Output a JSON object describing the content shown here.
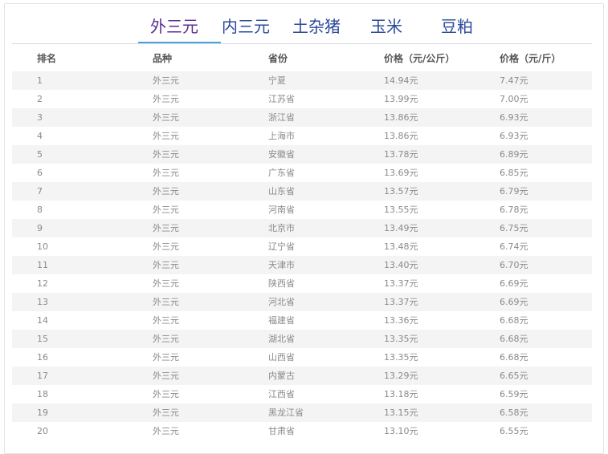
{
  "tabs": [
    {
      "label": "外三元",
      "active": true
    },
    {
      "label": "内三元",
      "active": false
    },
    {
      "label": "土杂猪",
      "active": false
    },
    {
      "label": "玉米",
      "active": false
    },
    {
      "label": "豆粕",
      "active": false
    }
  ],
  "table": {
    "headers": [
      "排名",
      "品种",
      "省份",
      "价格（元/公斤）",
      "价格（元/斤）"
    ],
    "rows": [
      [
        "1",
        "外三元",
        "宁夏",
        "14.94元",
        "7.47元"
      ],
      [
        "2",
        "外三元",
        "江苏省",
        "13.99元",
        "7.00元"
      ],
      [
        "3",
        "外三元",
        "浙江省",
        "13.86元",
        "6.93元"
      ],
      [
        "4",
        "外三元",
        "上海市",
        "13.86元",
        "6.93元"
      ],
      [
        "5",
        "外三元",
        "安徽省",
        "13.78元",
        "6.89元"
      ],
      [
        "6",
        "外三元",
        "广东省",
        "13.69元",
        "6.85元"
      ],
      [
        "7",
        "外三元",
        "山东省",
        "13.57元",
        "6.79元"
      ],
      [
        "8",
        "外三元",
        "河南省",
        "13.55元",
        "6.78元"
      ],
      [
        "9",
        "外三元",
        "北京市",
        "13.49元",
        "6.75元"
      ],
      [
        "10",
        "外三元",
        "辽宁省",
        "13.48元",
        "6.74元"
      ],
      [
        "11",
        "外三元",
        "天津市",
        "13.40元",
        "6.70元"
      ],
      [
        "12",
        "外三元",
        "陕西省",
        "13.37元",
        "6.69元"
      ],
      [
        "13",
        "外三元",
        "河北省",
        "13.37元",
        "6.69元"
      ],
      [
        "14",
        "外三元",
        "福建省",
        "13.36元",
        "6.68元"
      ],
      [
        "15",
        "外三元",
        "湖北省",
        "13.35元",
        "6.68元"
      ],
      [
        "16",
        "外三元",
        "山西省",
        "13.35元",
        "6.68元"
      ],
      [
        "17",
        "外三元",
        "内蒙古",
        "13.29元",
        "6.65元"
      ],
      [
        "18",
        "外三元",
        "江西省",
        "13.18元",
        "6.59元"
      ],
      [
        "19",
        "外三元",
        "黑龙江省",
        "13.15元",
        "6.58元"
      ],
      [
        "20",
        "外三元",
        "甘肃省",
        "13.10元",
        "6.55元"
      ]
    ]
  },
  "colors": {
    "tab_text": "#2b4a9b",
    "tab_active_text": "#5a2d91",
    "tab_underline": "#4aa3df",
    "stripe": "#f4f4f4"
  }
}
